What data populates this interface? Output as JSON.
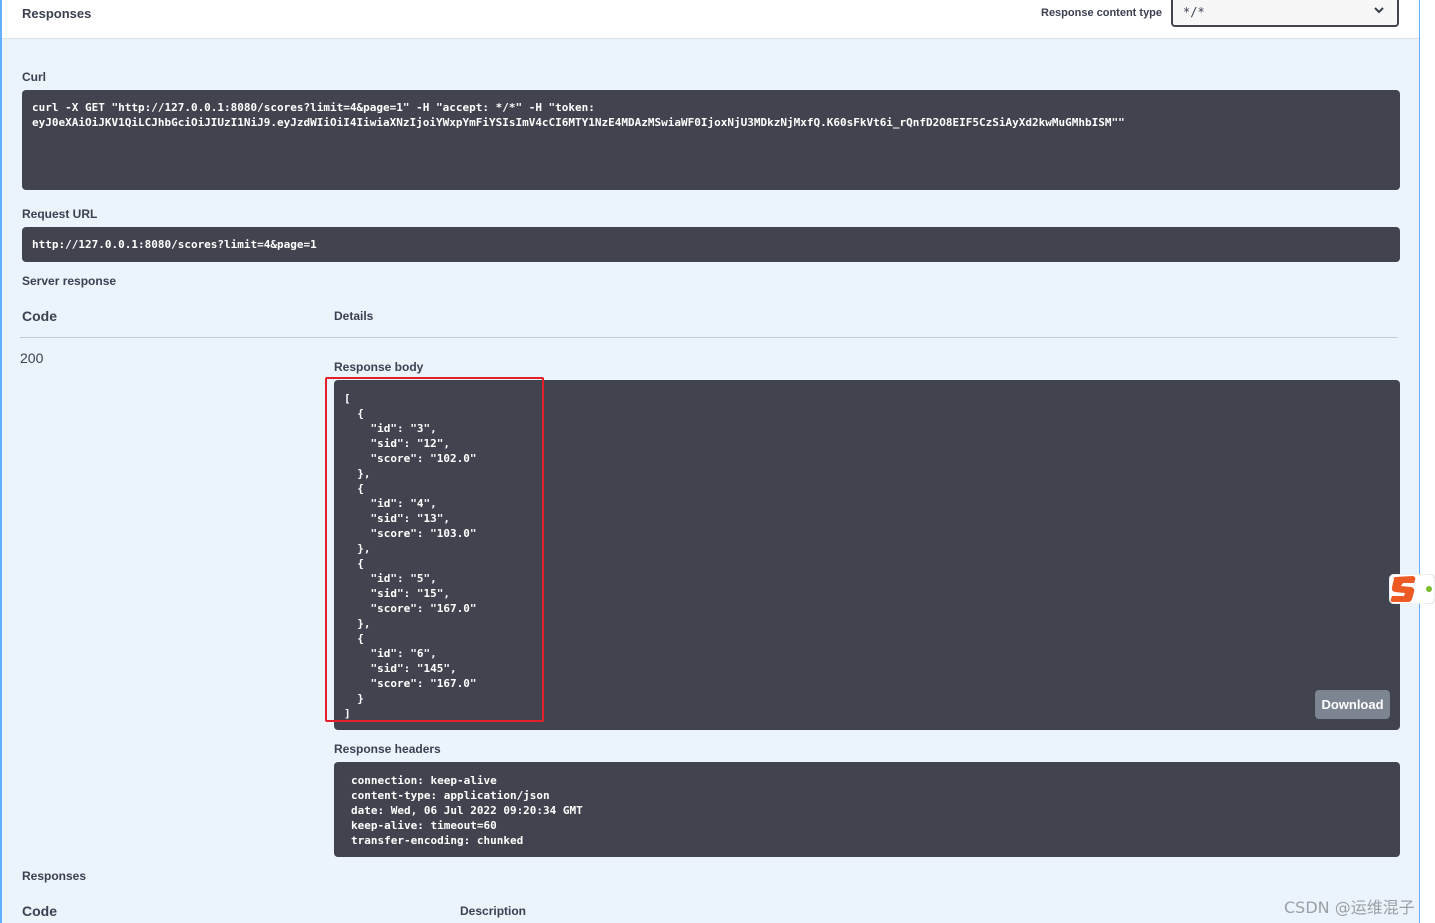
{
  "header": {
    "title": "Responses",
    "content_type_label": "Response content type",
    "content_type_value": "*/*"
  },
  "curl": {
    "label": "Curl",
    "command": "curl -X GET \"http://127.0.0.1:8080/scores?limit=4&page=1\" -H \"accept: */*\" -H \"token: \neyJ0eXAiOiJKV1QiLCJhbGciOiJIUzI1NiJ9.eyJzdWIiOiI4IiwiaXNzIjoiYWxpYmFiYSIsImV4cCI6MTY1NzE4MDAzMSwiaWF0IjoxNjU3MDkzNjMxfQ.K60sFkVt6i_rQnfD2O8EIF5CzSiAyXd2kwMuGMhbISM\"\""
  },
  "request_url": {
    "label": "Request URL",
    "value": "http://127.0.0.1:8080/scores?limit=4&page=1"
  },
  "server_response": {
    "label": "Server response",
    "col_code": "Code",
    "col_details": "Details",
    "code": "200",
    "body_label": "Response body",
    "body": "[\n  {\n    \"id\": \"3\",\n    \"sid\": \"12\",\n    \"score\": \"102.0\"\n  },\n  {\n    \"id\": \"4\",\n    \"sid\": \"13\",\n    \"score\": \"103.0\"\n  },\n  {\n    \"id\": \"5\",\n    \"sid\": \"15\",\n    \"score\": \"167.0\"\n  },\n  {\n    \"id\": \"6\",\n    \"sid\": \"145\",\n    \"score\": \"167.0\"\n  }\n]",
    "download_label": "Download",
    "headers_label": "Response headers",
    "headers": "connection: keep-alive\ncontent-type: application/json\ndate: Wed, 06 Jul 2022 09:20:34 GMT\nkeep-alive: timeout=60\ntransfer-encoding: chunked"
  },
  "responses": {
    "label": "Responses",
    "col_code": "Code",
    "col_description": "Description"
  },
  "watermark": "CSDN @运维混子",
  "icons": {
    "select_arrow": "chevron-down-icon",
    "floating": "sogou-ime-icon"
  },
  "colors": {
    "panel_bg": "#ebf3fb",
    "border": "#61affe",
    "code_bg": "#41444e",
    "highlight": "#e5202a",
    "button": "#7d8492"
  }
}
